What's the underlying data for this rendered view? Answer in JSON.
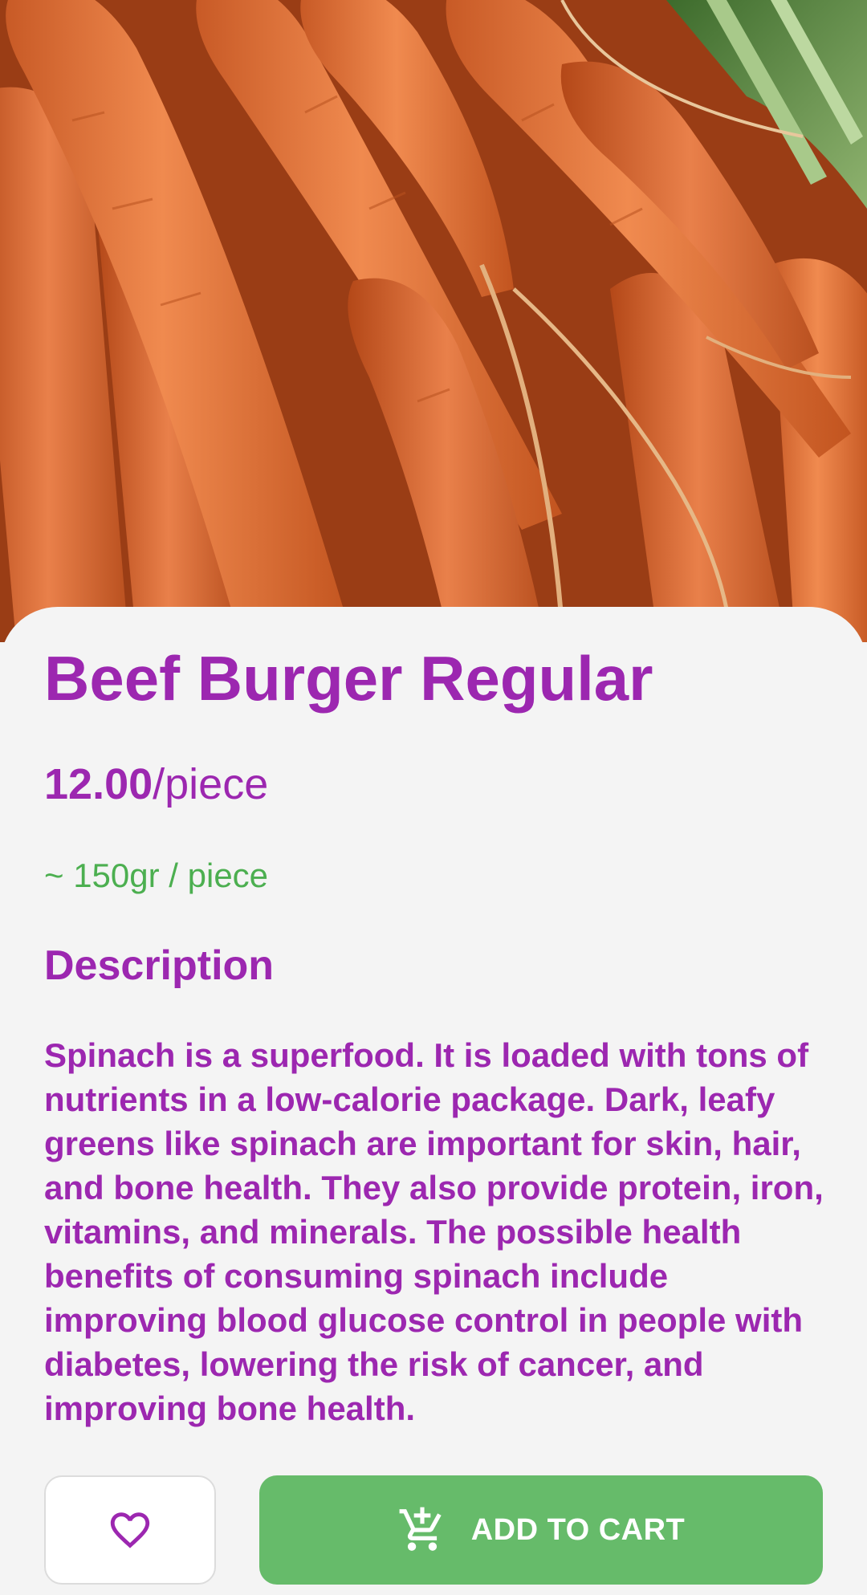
{
  "product": {
    "image_alt": "carrots",
    "title": "Beef Burger Regular",
    "price_value": "12.00",
    "price_unit": "/piece",
    "weight": "~ 150gr / piece",
    "description_heading": "Description",
    "description": "Spinach is a superfood. It is loaded with tons of nutrients in a low-calorie package. Dark, leafy greens like spinach are important for skin, hair, and bone health. They also provide protein, iron, vitamins, and minerals. The possible health benefits of consuming spinach include improving blood glucose control in people with diabetes, lowering the risk of cancer, and improving bone health."
  },
  "actions": {
    "favorite_icon": "heart-outline-icon",
    "cart_icon": "add-shopping-cart-icon",
    "add_to_cart_label": "ADD TO CART"
  },
  "colors": {
    "primary": "#9c27b0",
    "accent_green": "#4caf50",
    "button_green": "#66bb6a",
    "background": "#f4f4f4"
  }
}
